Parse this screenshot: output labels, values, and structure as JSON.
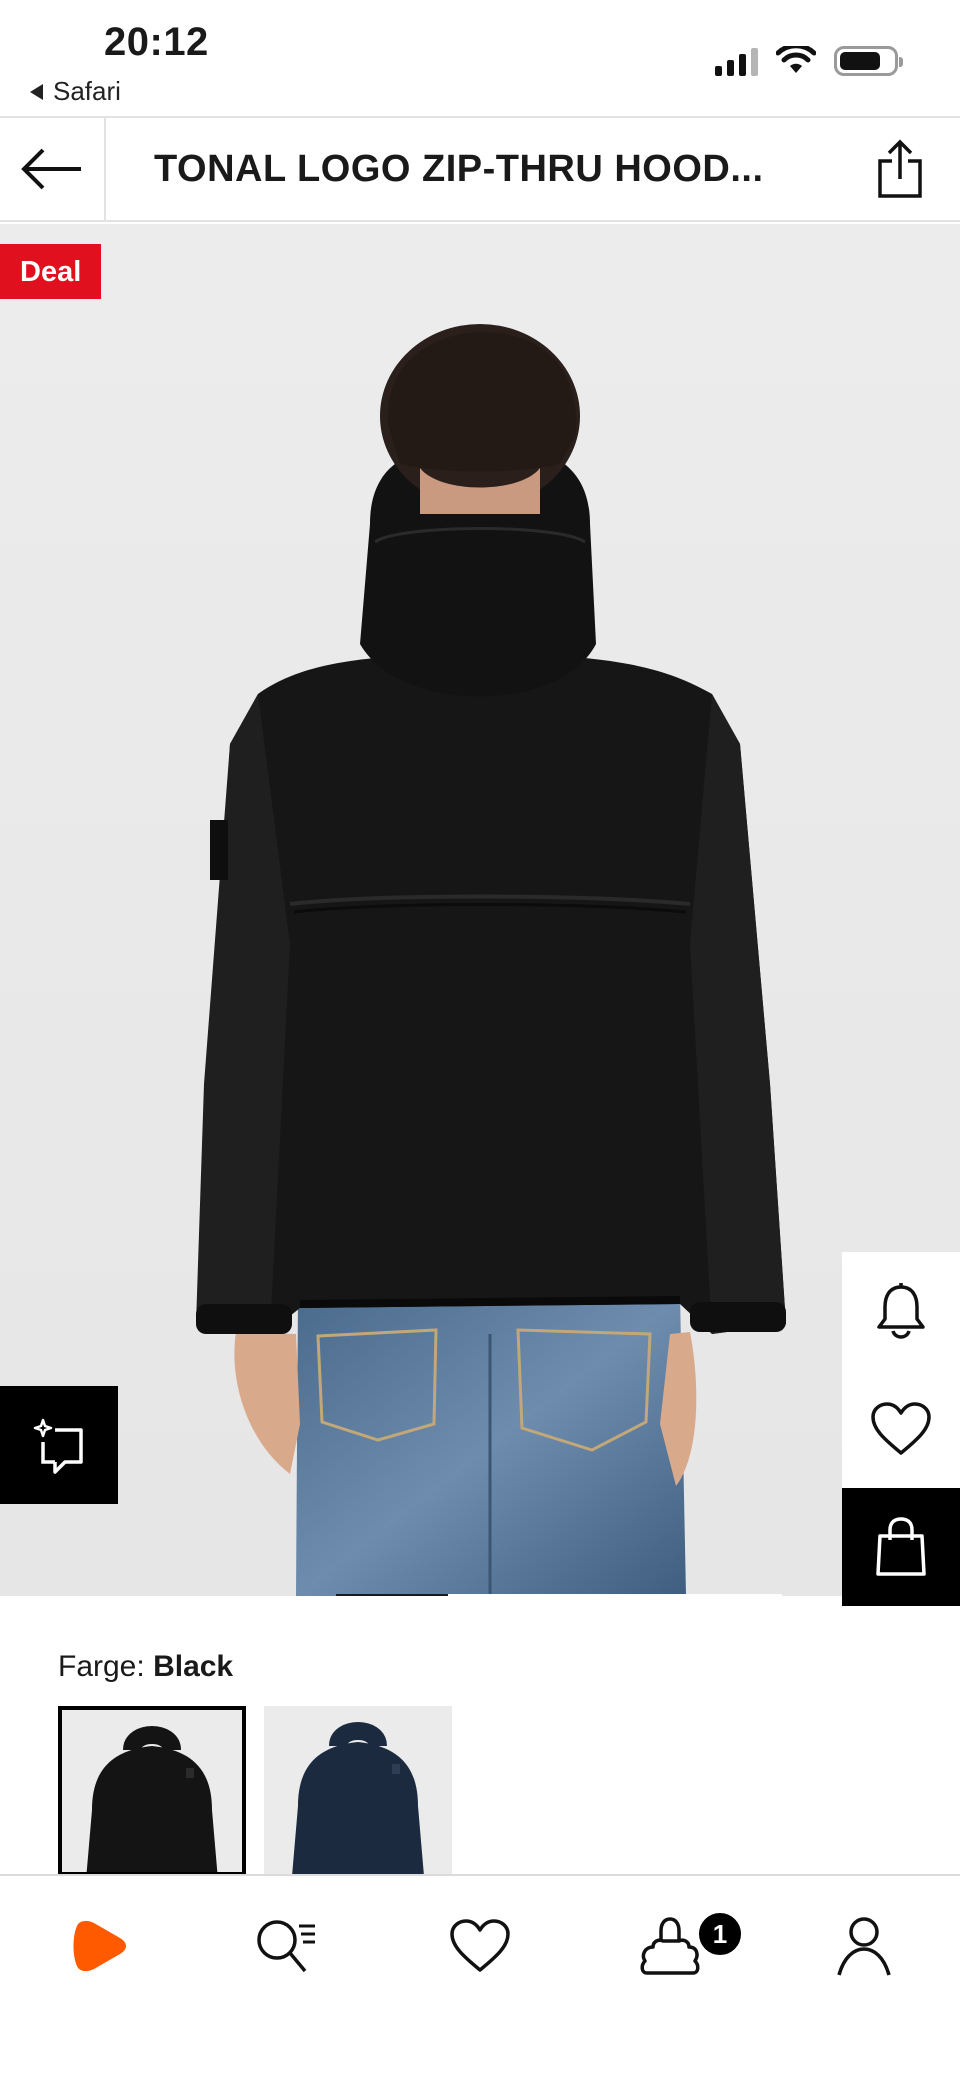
{
  "status": {
    "time": "20:12",
    "back_app": "Safari"
  },
  "header": {
    "title": "TONAL LOGO ZIP-THRU HOOD..."
  },
  "hero": {
    "deal_badge": "Deal",
    "image_alt": "Model wearing black hooded zip-thru jacket, back view",
    "gallery_position": 0.25
  },
  "color_selector": {
    "label_prefix": "Farge:",
    "selected_color": "Black",
    "swatches": [
      {
        "name": "Black",
        "color": "#141414",
        "selected": true
      },
      {
        "name": "Navy",
        "color": "#1c2a40",
        "selected": false
      }
    ]
  },
  "bottom_nav": {
    "items": [
      {
        "id": "home",
        "icon": "zalando-logo-icon"
      },
      {
        "id": "search",
        "icon": "search-icon"
      },
      {
        "id": "wishlist",
        "icon": "heart-icon"
      },
      {
        "id": "bag",
        "icon": "bag-icon"
      },
      {
        "id": "profile",
        "icon": "user-icon"
      }
    ],
    "bag_count": "1"
  },
  "colors": {
    "deal_red": "#e0101e",
    "brand_orange": "#ff6900",
    "background": "#ebebeb"
  }
}
